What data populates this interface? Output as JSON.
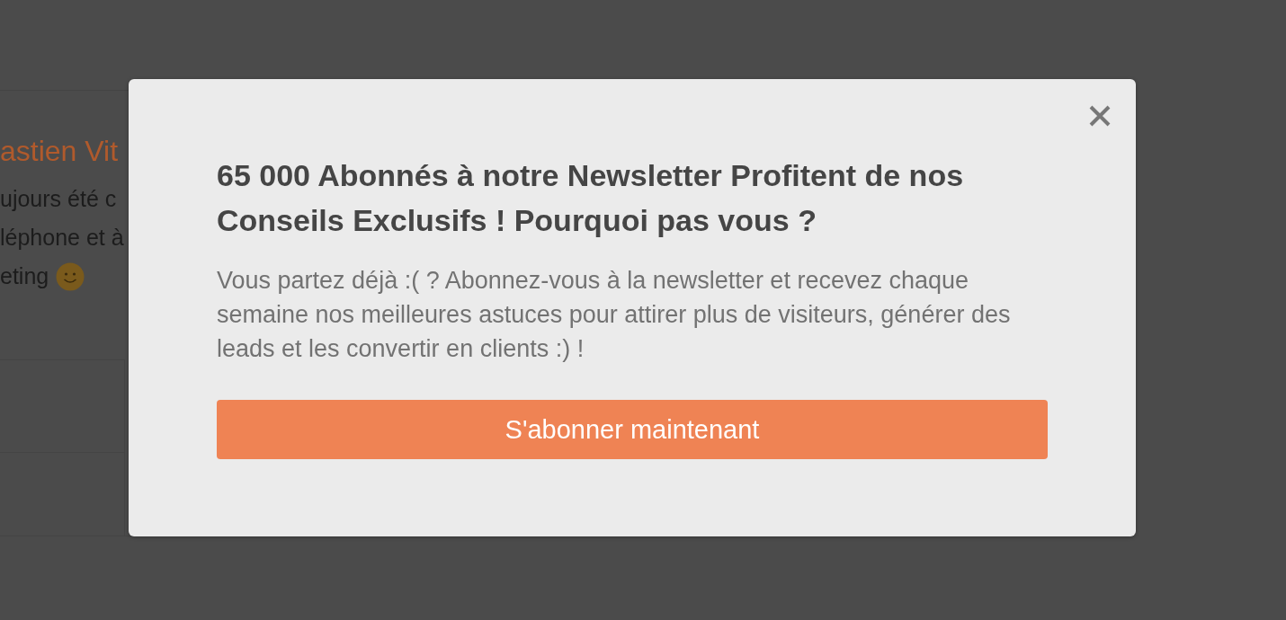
{
  "background_page": {
    "author_name": "astien Vit",
    "text_lines": [
      "ujours été c",
      "léphone et à",
      "eting"
    ]
  },
  "modal": {
    "title": "65 000 Abonnés à notre Newsletter Profitent de nos Conseils Exclusifs ! Pourquoi pas vous ?",
    "message": "Vous partez déjà :( ? Abonnez-vous à la newsletter et recevez chaque semaine nos meilleures astuces pour attirer plus de visiteurs, générer des leads et les convertir en clients :) !",
    "button": "S'abonner maintenant"
  }
}
